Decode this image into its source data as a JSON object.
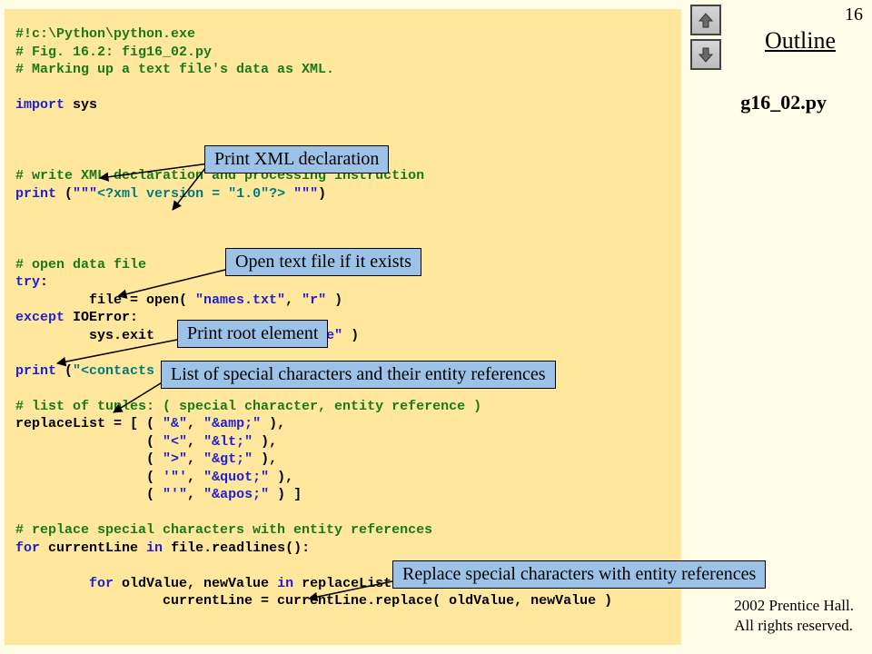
{
  "page_number": "16",
  "outline_label": "Outline",
  "file_label_partial": "g16_02.py",
  "credit_line1": " 2002 Prentice Hall.",
  "credit_line2": "All rights reserved.",
  "callouts": {
    "c1": "Print XML declaration",
    "c2": "Open text file if it exists",
    "c3": "Print root element",
    "c4": "List of special characters and their entity references",
    "c5": "Replace special characters with entity references"
  },
  "code": {
    "l1": "#!c:\\Python\\python.exe",
    "l2": "# Fig. 16.2: fig16_02.py",
    "l3": "# Marking up a text file's data as XML.",
    "l5a": "import",
    "l5b": " sys",
    "l8": "# write XML declaration and processing instruction",
    "l9a": "print",
    "l9b": " (",
    "l9c": "\"\"\"",
    "l9d": "<?xml version = \"1.0\"?>",
    "l9e": " \"\"\"",
    "l9f": ")",
    "l12": "# open data file",
    "l13a": "try",
    "l13b": ":",
    "l14a": "         file = open( ",
    "l14b": "\"names.txt\"",
    "l14c": ", ",
    "l14d": "\"r\"",
    "l14e": " )",
    "l15a": "except",
    "l15b": " IOError:",
    "l16a": "         sys.exit",
    "l16c": "ile\"",
    "l16d": " )",
    "l18a": "print",
    "l18b": " (",
    "l18c": "\"<contacts",
    "l20": "# list of tuples: ( special character, entity reference )",
    "l21a": "replaceList = [ ( ",
    "l21b": "\"&\"",
    "l21c": ", ",
    "l21d": "\"&amp;\"",
    "l21e": " ),",
    "l22a": "                ( ",
    "l22b": "\"<\"",
    "l22c": ", ",
    "l22d": "\"&lt;\"",
    "l22e": " ),",
    "l23a": "                ( ",
    "l23b": "\">\"",
    "l23c": ", ",
    "l23d": "\"&gt;\"",
    "l23e": " ),",
    "l24a": "                ( ",
    "l24b": "'\"'",
    "l24c": ", ",
    "l24d": "\"&quot;\"",
    "l24e": " ),",
    "l25a": "                ( ",
    "l25b": "\"'\"",
    "l25c": ", ",
    "l25d": "\"&apos;\"",
    "l25e": " ) ]",
    "l27": "# replace special characters with entity references",
    "l28a": "for",
    "l28b": " currentLine ",
    "l28c": "in",
    "l28d": " file.readlines():",
    "l30a": "         ",
    "l30b": "for",
    "l30c": " oldValue, newValue ",
    "l30d": "in",
    "l30e": " replaceList:",
    "l31": "                  currentLine = currentLine.replace( oldValue, newValue )"
  }
}
